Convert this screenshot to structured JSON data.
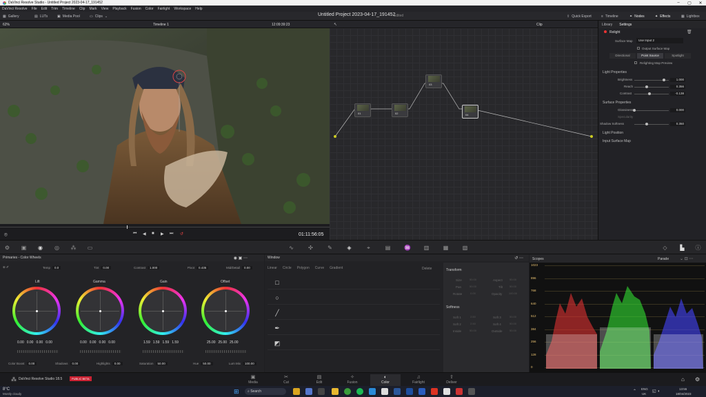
{
  "window": {
    "title": "DaVinci Resolve Studio - Untitled Project 2023-04-17_191452",
    "min": "–",
    "max": "▢",
    "close": "✕"
  },
  "menu": [
    "DaVinci Resolve",
    "File",
    "Edit",
    "Trim",
    "Timeline",
    "Clip",
    "Mark",
    "View",
    "Playback",
    "Fusion",
    "Color",
    "Fairlight",
    "Workspace",
    "Help"
  ],
  "toolbar": {
    "gallery": "Gallery",
    "luts": "LUTs",
    "media_pool": "Media Pool",
    "clips": "Clips",
    "project_title": "Untitled Project 2023-04-17_191452",
    "project_status": "Edited",
    "quick_export": "Quick Export",
    "timeline": "Timeline",
    "nodes": "Nodes",
    "effects": "Effects",
    "lightbox": "Lightbox"
  },
  "viewer": {
    "zoom": "62%",
    "timeline_name": "Timeline 1",
    "timecode": "12:09:39:23",
    "clip_timecode": "01:11:56:05",
    "clip_mode": "Clip"
  },
  "nodes": [
    {
      "label": "01"
    },
    {
      "label": "02"
    },
    {
      "label": "03"
    },
    {
      "label": "04"
    }
  ],
  "inspector": {
    "tab_library": "Library",
    "tab_settings": "Settings",
    "effect_name": "Relight",
    "surface_map_label": "Surface Map",
    "surface_map_value": "Use Input 2",
    "output_surface_map": "Output Surface Map",
    "btn_directional": "Directional",
    "btn_point_source": "Point Source",
    "btn_spotlight": "Spotlight",
    "relighting_preview": "Relighting Map Preview",
    "light_properties": "Light Properties",
    "brightness_label": "Brightness",
    "brightness": "1.000",
    "brightness_level": 0.85,
    "reach_label": "Reach",
    "reach": "0.356",
    "reach_level": 0.36,
    "contrast_label": "Contrast",
    "contrast": "-0.138",
    "contrast_level": 0.43,
    "surface_properties": "Surface Properties",
    "glossiness_label": "Glossiness",
    "glossiness": "0.000",
    "glossiness_level": 0.0,
    "specularity_label": "Specularity",
    "shadow_softness_label": "Shadow Softness",
    "shadow_softness": "0.350",
    "shadow_softness_level": 0.35,
    "light_position": "Light Position",
    "input_surface_map": "Input Surface Map"
  },
  "primaries": {
    "title": "Primaries - Color Wheels",
    "temp_label": "Temp",
    "temp": "0.0",
    "tint_label": "Tint",
    "tint": "0.00",
    "contrast_label": "Contrast",
    "contrast": "1.000",
    "pivot_label": "Pivot",
    "pivot": "0.435",
    "middetail_label": "Mid/Detail",
    "middetail": "0.00",
    "wheels": [
      {
        "name": "Lift",
        "values": [
          "0.00",
          "0.00",
          "0.00",
          "0.00"
        ]
      },
      {
        "name": "Gamma",
        "values": [
          "0.00",
          "0.00",
          "0.00",
          "0.00"
        ]
      },
      {
        "name": "Gain",
        "values": [
          "1.59",
          "1.59",
          "1.59",
          "1.59"
        ]
      },
      {
        "name": "Offset",
        "values": [
          "25.00",
          "25.00",
          "25.00"
        ]
      }
    ],
    "color_boost_label": "Color Boost",
    "color_boost": "0.00",
    "shadows_label": "Shadows",
    "shadows": "0.00",
    "highlights_label": "Highlights",
    "highlights": "0.00",
    "saturation_label": "Saturation",
    "saturation": "50.00",
    "hue_label": "Hue",
    "hue": "50.00",
    "lummix_label": "Lum Mix",
    "lummix": "100.00"
  },
  "window_panel": {
    "title": "Window",
    "linear": "Linear",
    "circle": "Circle",
    "polygon": "Polygon",
    "curve": "Curve",
    "gradient": "Gradient",
    "delete": "Delete",
    "transform": "Transform",
    "size": "Size",
    "size_val": "50.00",
    "pan": "Pan",
    "pan_val": "50.00",
    "rotate": "Rotate",
    "rotate_val": "0.00",
    "aspect": "Aspect",
    "aspect_val": "50.00",
    "tilt": "Tilt",
    "tilt_val": "50.00",
    "opacity": "Opacity",
    "opacity_val": "100.00",
    "softness": "Softness",
    "soft1": "Soft 1",
    "soft1_val": "2.50",
    "soft2": "Soft 2",
    "soft2_val": "2.50",
    "inside": "Inside",
    "inside_val": "50.00",
    "soft3": "Soft 3",
    "soft3_val": "50.00",
    "soft4": "Soft 4",
    "soft4_val": "50.00",
    "outside": "Outside",
    "outside_val": "50.00"
  },
  "scopes": {
    "title": "Scopes",
    "mode": "Parade",
    "ticks": [
      "1023",
      "896",
      "768",
      "640",
      "512",
      "384",
      "256",
      "128",
      "0"
    ]
  },
  "pages": [
    "Media",
    "Cut",
    "Edit",
    "Fusion",
    "Color",
    "Fairlight",
    "Deliver"
  ],
  "app_brand": "DaVinci Resolve Studio 18.5",
  "beta_badge": "PUBLIC BETA",
  "taskbar": {
    "weather_temp": "8°C",
    "weather_desc": "Mostly cloudy",
    "search": "Search",
    "lang": "ENG",
    "region": "UK",
    "time": "13:55",
    "date": "18/04/2023"
  }
}
